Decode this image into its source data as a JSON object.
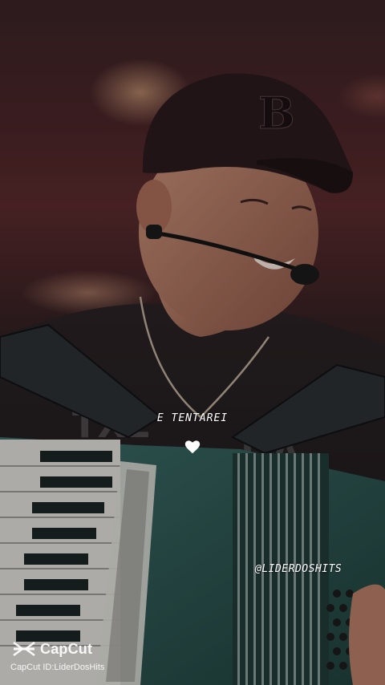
{
  "video": {
    "lyric_text": "E TENTAREI",
    "lyric_icon": "heart-icon",
    "watermark_handle": "@LIDERDOSHITS"
  },
  "capcut": {
    "brand_name": "CapCut",
    "id_text": "CapCut ID:LiderDosHits",
    "logo_icon": "capcut-logo-icon"
  },
  "colors": {
    "overlay_text": "#ffffff",
    "background_warm": "#5a2a2c",
    "accordion_teal": "#2f5b57"
  }
}
